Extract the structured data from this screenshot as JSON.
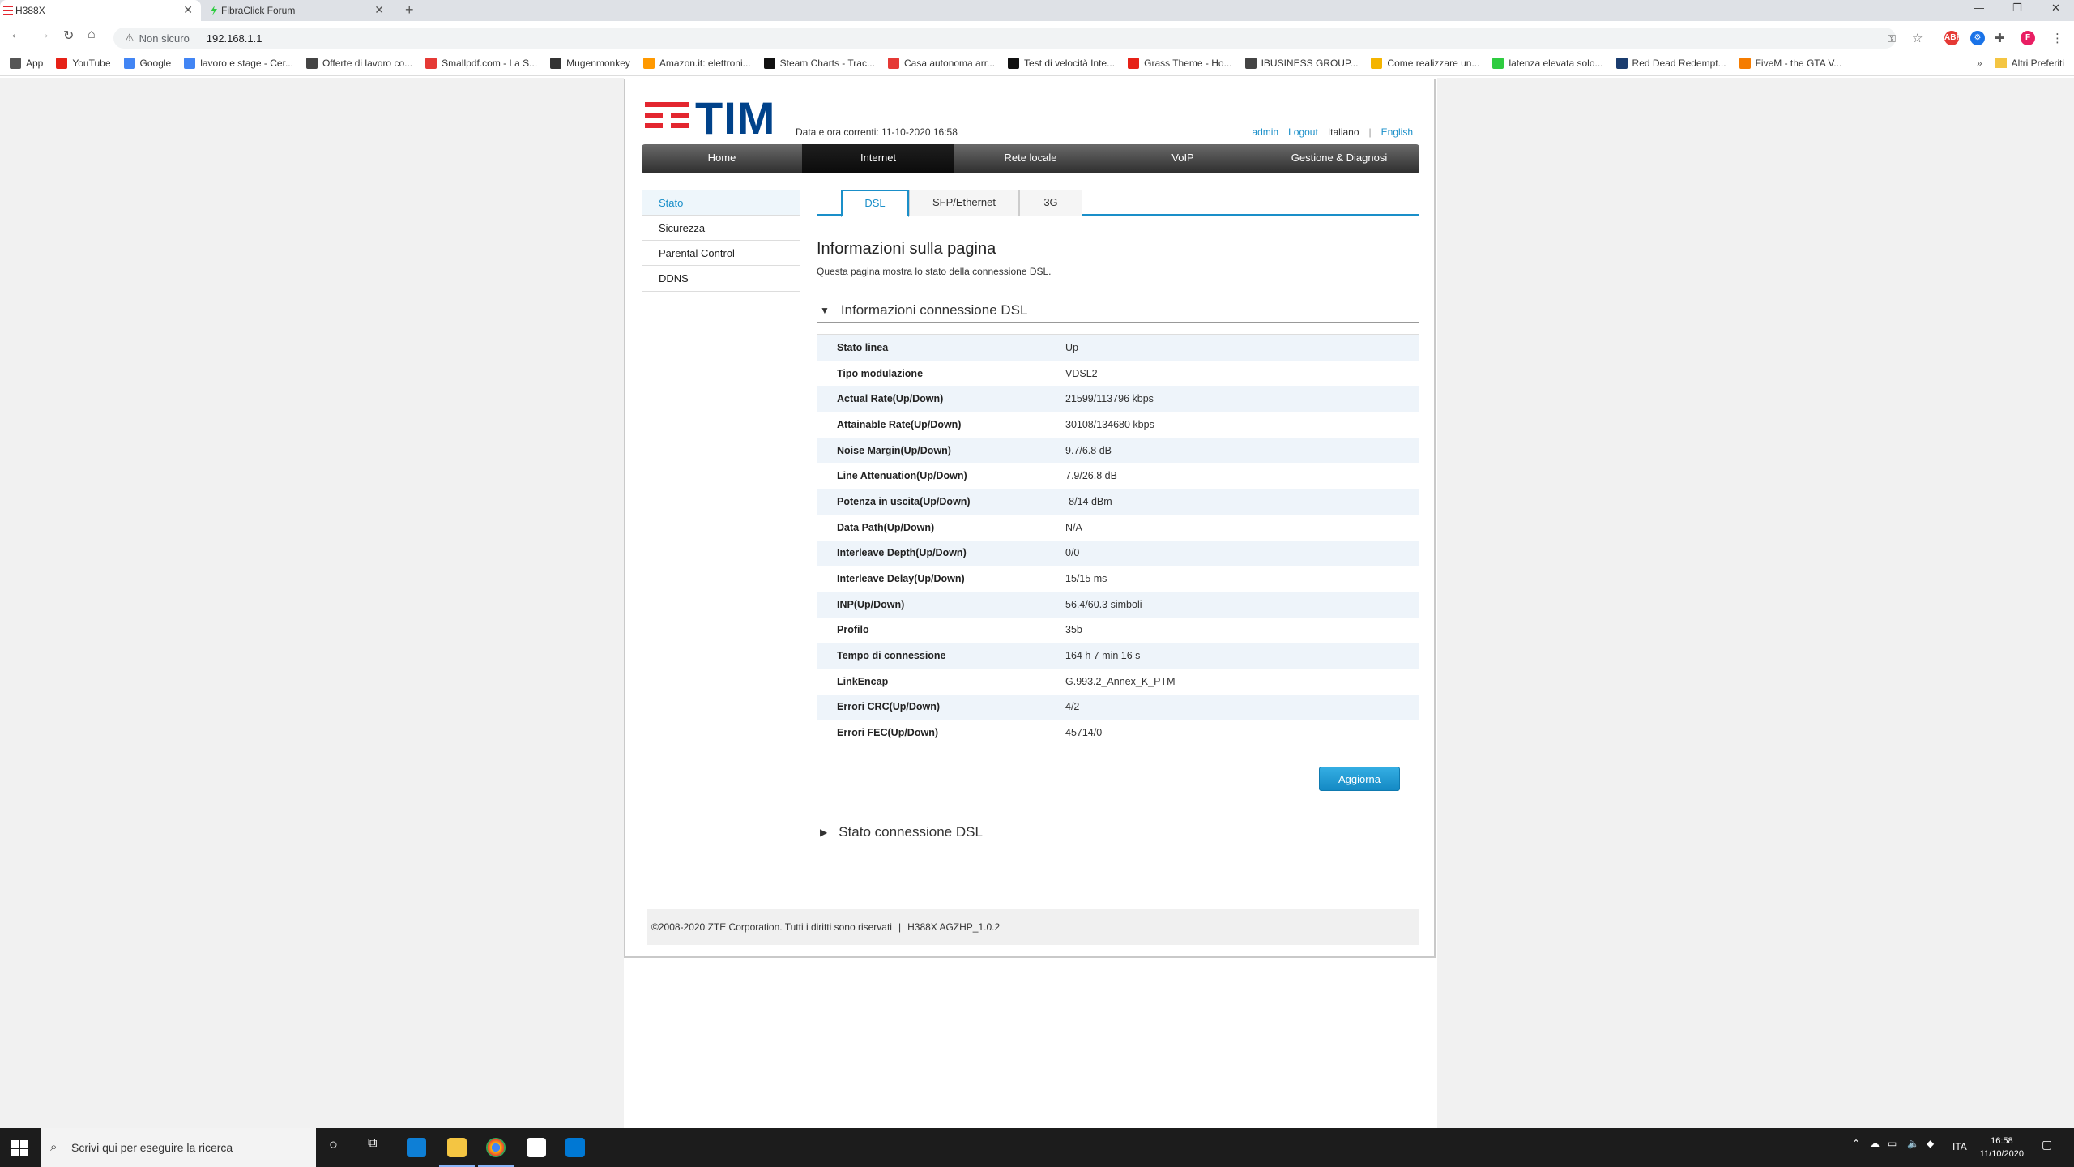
{
  "browser": {
    "tabs": [
      {
        "title": "H388X",
        "active": true
      },
      {
        "title": "FibraClick Forum",
        "active": false
      }
    ],
    "new_tab_label": "+",
    "security_label": "Non sicuro",
    "url": "192.168.1.1",
    "bookmarks": [
      {
        "label": "App",
        "color": "#555555"
      },
      {
        "label": "YouTube",
        "color": "#e62117"
      },
      {
        "label": "Google",
        "color": "#4285f4"
      },
      {
        "label": "lavoro e stage - Cer...",
        "color": "#4285f4"
      },
      {
        "label": "Offerte di lavoro co...",
        "color": "#444444"
      },
      {
        "label": "Smallpdf.com - La S...",
        "color": "#e53935"
      },
      {
        "label": "Mugenmonkey",
        "color": "#333333"
      },
      {
        "label": "Amazon.it: elettroni...",
        "color": "#ff9900"
      },
      {
        "label": "Steam Charts - Trac...",
        "color": "#111111"
      },
      {
        "label": "Casa autonoma arr...",
        "color": "#e53935"
      },
      {
        "label": "Test di velocità Inte...",
        "color": "#111111"
      },
      {
        "label": "Grass Theme - Ho...",
        "color": "#e62117"
      },
      {
        "label": "IBUSINESS GROUP...",
        "color": "#444444"
      },
      {
        "label": "Come realizzare un...",
        "color": "#f4b400"
      },
      {
        "label": "latenza elevata solo...",
        "color": "#2ecc40"
      },
      {
        "label": "Red Dead Redempt...",
        "color": "#1a3c6e"
      },
      {
        "label": "FiveM - the GTA V...",
        "color": "#f57c00"
      }
    ],
    "other_bookmarks_label": "Altri Preferiti"
  },
  "router": {
    "brand": "TIM",
    "datetime_label": "Data e ora correnti: 11-10-2020 16:58",
    "user_link": "admin",
    "logout_link": "Logout",
    "lang_current": "Italiano",
    "lang_sep": "|",
    "lang_other": "English",
    "nav": [
      {
        "label": "Home",
        "active": false
      },
      {
        "label": "Internet",
        "active": true
      },
      {
        "label": "Rete locale",
        "active": false
      },
      {
        "label": "VoIP",
        "active": false
      },
      {
        "label": "Gestione & Diagnosi",
        "active": false
      }
    ],
    "sidemenu": [
      {
        "label": "Stato",
        "active": true
      },
      {
        "label": "Sicurezza",
        "active": false
      },
      {
        "label": "Parental Control",
        "active": false
      },
      {
        "label": "DDNS",
        "active": false
      }
    ],
    "subtabs": [
      {
        "label": "DSL",
        "active": true
      },
      {
        "label": "SFP/Ethernet",
        "active": false
      },
      {
        "label": "3G",
        "active": false
      }
    ],
    "page_title": "Informazioni sulla pagina",
    "page_description": "Questa pagina mostra lo stato della connessione DSL.",
    "section_info_title": "Informazioni connessione DSL",
    "section_state_title": "Stato connessione DSL",
    "info_rows": [
      {
        "label": "Stato linea",
        "value": "Up"
      },
      {
        "label": "Tipo modulazione",
        "value": "VDSL2"
      },
      {
        "label": "Actual Rate(Up/Down)",
        "value": "21599/113796 kbps"
      },
      {
        "label": "Attainable Rate(Up/Down)",
        "value": "30108/134680 kbps"
      },
      {
        "label": "Noise Margin(Up/Down)",
        "value": "9.7/6.8 dB"
      },
      {
        "label": "Line Attenuation(Up/Down)",
        "value": "7.9/26.8 dB"
      },
      {
        "label": "Potenza in uscita(Up/Down)",
        "value": "-8/14 dBm"
      },
      {
        "label": "Data Path(Up/Down)",
        "value": "N/A"
      },
      {
        "label": "Interleave Depth(Up/Down)",
        "value": "0/0"
      },
      {
        "label": "Interleave Delay(Up/Down)",
        "value": "15/15 ms"
      },
      {
        "label": "INP(Up/Down)",
        "value": "56.4/60.3 simboli"
      },
      {
        "label": "Profilo",
        "value": "35b"
      },
      {
        "label": "Tempo di connessione",
        "value": "164 h 7 min 16 s"
      },
      {
        "label": "LinkEncap",
        "value": "G.993.2_Annex_K_PTM"
      },
      {
        "label": "Errori CRC(Up/Down)",
        "value": "4/2"
      },
      {
        "label": "Errori FEC(Up/Down)",
        "value": "45714/0"
      }
    ],
    "refresh_button": "Aggiorna",
    "footer_copyright": "©2008-2020 ZTE Corporation. Tutti i diritti sono riservati",
    "footer_sep": "|",
    "footer_model": "H388X AGZHP_1.0.2",
    "colors": {
      "accent": "#1a8fc9",
      "brand_red": "#e3262f",
      "brand_blue": "#00428a"
    }
  },
  "taskbar": {
    "search_placeholder": "Scrivi qui per eseguire la ricerca",
    "lang": "ITA",
    "time": "16:58",
    "date": "11/10/2020"
  }
}
